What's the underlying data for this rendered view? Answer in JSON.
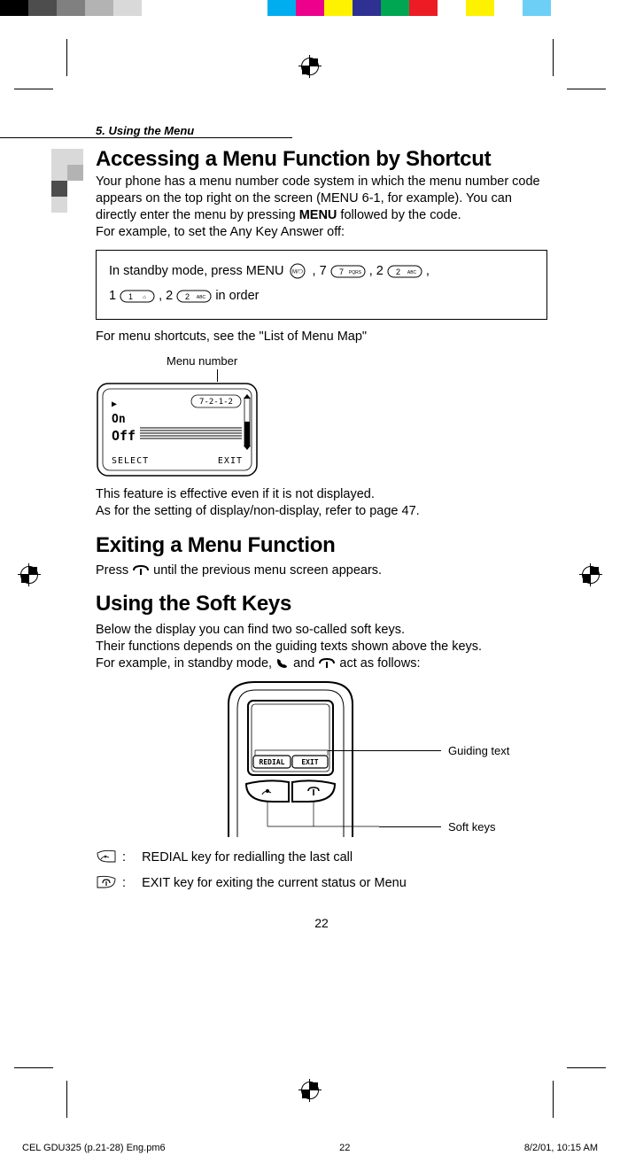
{
  "color_bar": [
    "#000000",
    "#4d4d4d",
    "#808080",
    "#b3b3b3",
    "#d9d9d9",
    "#ffffff",
    "#ffffff",
    "#ffffff",
    "#00aeef",
    "#ec008c",
    "#fff200",
    "#2e3192",
    "#00a651",
    "#ed1c24",
    "#ffffff",
    "#fff200",
    "#ffffff",
    "#6dcff6",
    "#ffffff"
  ],
  "chapter": "5. Using the Menu",
  "h1": "Accessing a Menu Function by Shortcut",
  "p1a": "Your phone has a menu number code system in which the menu number code appears on the top right on the screen (MENU 6-1, for example). You can directly enter the menu  by pressing ",
  "p1b": "MENU",
  "p1c": " followed by the code.",
  "p1d": "For example, to set the Any Key Answer off:",
  "seq1": "In standby mode, press MENU ",
  "seq2": " ,    7 ",
  "seq3": " ,    2 ",
  "seq4": " ,",
  "seq5": "1 ",
  "seq6": " ,    2 ",
  "seq7": "  in order",
  "p2": "For menu shortcuts, see the \"List of Menu Map\"",
  "menu_number_label": "Menu number",
  "lcd": {
    "line_top": "7-2-1-2",
    "arrow": "▶",
    "opt1": "On",
    "opt2": "Off",
    "left": "SELECT",
    "right": "EXIT"
  },
  "p3a": "This feature is effective even if it is not displayed.",
  "p3b": "As for the setting of display/non-display, refer to page 47.",
  "h2a": "Exiting a Menu Function",
  "p4a": "Press ",
  "p4b": " until the previous menu screen appears.",
  "h2b": "Using the Soft Keys",
  "p5a": "Below the display you can find two so-called soft keys.",
  "p5b": "Their functions depends on the guiding texts shown above the keys.",
  "p5c_a": "For example, in standby mode, ",
  "p5c_b": " and ",
  "p5c_c": " act as follows:",
  "callout_guiding": "Guiding text",
  "callout_soft": "Soft keys",
  "phone_lcd_left": "REDIAL",
  "phone_lcd_right": "EXIT",
  "kd_colon": ":",
  "kd1": "REDIAL key for redialling the last call",
  "kd2": "EXIT key for exiting the current status or Menu",
  "page_number": "22",
  "footer_left": "CEL GDU325 (p.21-28) Eng.pm6",
  "footer_mid": "22",
  "footer_right": "8/2/01, 10:15 AM"
}
